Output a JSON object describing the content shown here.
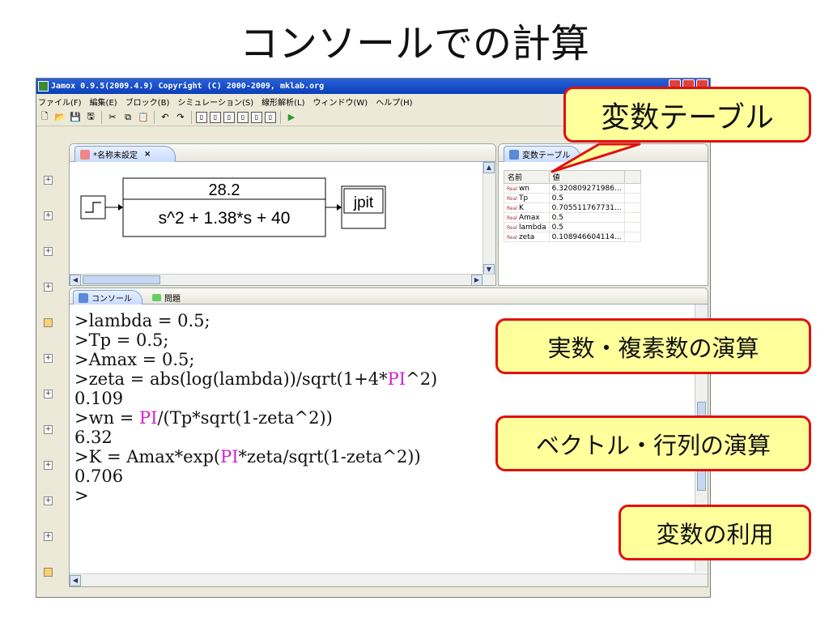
{
  "slide": {
    "title": "コンソールでの計算"
  },
  "window": {
    "title": "Jamox 0.9.5(2009.4.9) Copyright (C) 2000-2009, mklab.org"
  },
  "menu": [
    "ファイル(F)",
    "編集(E)",
    "ブロック(B)",
    "シミュレーション(S)",
    "線形解析(L)",
    "ウィンドウ(W)",
    "ヘルプ(H)"
  ],
  "editor": {
    "tab_label": "*名称未設定",
    "tab_close": "×",
    "block": {
      "numerator": "28.2",
      "denominator": "s^2 + 1.38*s + 40",
      "output": "jpit"
    }
  },
  "variables": {
    "tab_label": "変数テーブル",
    "headers": [
      "名前",
      "値"
    ],
    "type_tag": "Real",
    "rows": [
      {
        "name": "wn",
        "value": "6.320809271986..."
      },
      {
        "name": "Tp",
        "value": "0.5"
      },
      {
        "name": "K",
        "value": "0.705511767731..."
      },
      {
        "name": "Amax",
        "value": "0.5"
      },
      {
        "name": "lambda",
        "value": "0.5"
      },
      {
        "name": "zeta",
        "value": "0.108946604114..."
      }
    ]
  },
  "console": {
    "tab_label": "コンソール",
    "tab2_label": "問題",
    "lines": [
      [
        ">lambda = 0.5;"
      ],
      [
        ">Tp = 0.5;"
      ],
      [
        ">Amax = 0.5;"
      ],
      [
        ">zeta = abs(log(lambda))/sqrt(1+4*",
        "PI",
        "^2)"
      ],
      [
        "0.109"
      ],
      [
        ">wn = ",
        "PI",
        "/(Tp*sqrt(1-zeta^2))"
      ],
      [
        "6.32"
      ],
      [
        ">K = Amax*exp(",
        "PI",
        "*zeta/sqrt(1-zeta^2))"
      ],
      [
        "0.706"
      ],
      [
        ">"
      ]
    ],
    "highlight_color": "#d020d0"
  },
  "callouts": {
    "variable_table": "変数テーブル",
    "real_complex": "実数・複素数の演算",
    "vector_matrix": "ベクトル・行列の演算",
    "variable_use": "変数の利用"
  }
}
